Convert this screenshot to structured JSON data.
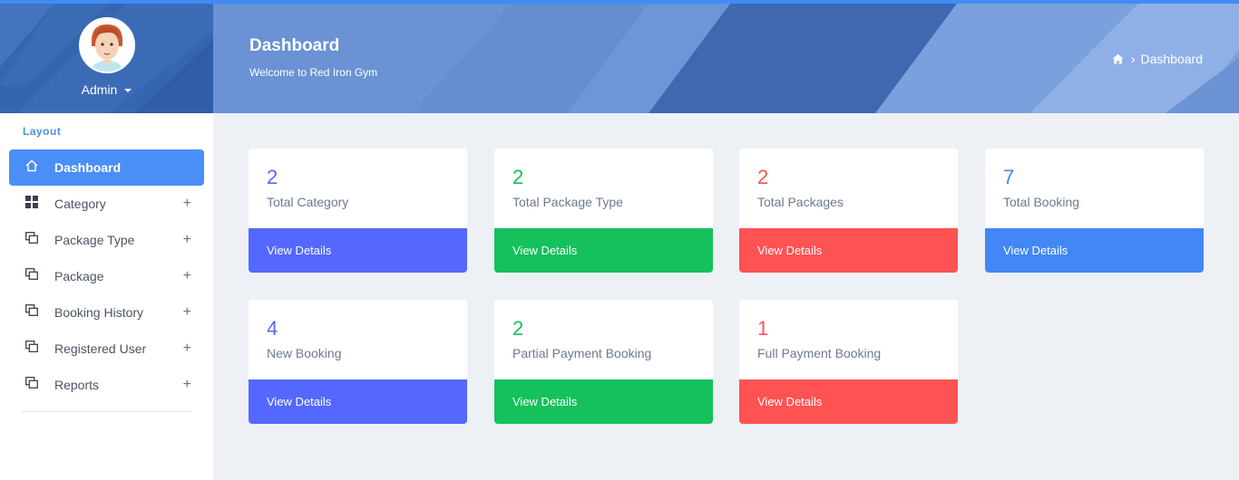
{
  "sidebar": {
    "user_label": "Admin",
    "nav_caption": "Layout",
    "items": [
      {
        "label": "Dashboard",
        "icon": "home-icon",
        "active": true
      },
      {
        "label": "Category",
        "icon": "grid-icon",
        "expandable": true
      },
      {
        "label": "Package Type",
        "icon": "windows-icon",
        "expandable": true
      },
      {
        "label": "Package",
        "icon": "windows-icon",
        "expandable": true
      },
      {
        "label": "Booking History",
        "icon": "windows-icon",
        "expandable": true
      },
      {
        "label": "Registered User",
        "icon": "windows-icon",
        "expandable": true
      },
      {
        "label": "Reports",
        "icon": "windows-icon",
        "expandable": true
      }
    ],
    "expand_symbol": "+"
  },
  "header": {
    "title": "Dashboard",
    "subtitle": "Welcome to Red Iron Gym",
    "breadcrumb": {
      "home_icon": "home-icon",
      "separator": "›",
      "current": "Dashboard"
    }
  },
  "colors": {
    "accent": "#4a8ff7",
    "indigo": "#5468ff",
    "green": "#14c15c",
    "red": "#ff5252",
    "blue": "#4287f5"
  },
  "cards": [
    {
      "value": "2",
      "caption": "Total Category",
      "link": "View Details",
      "color": "indigo"
    },
    {
      "value": "2",
      "caption": "Total Package Type",
      "link": "View Details",
      "color": "green"
    },
    {
      "value": "2",
      "caption": "Total Packages",
      "link": "View Details",
      "color": "red"
    },
    {
      "value": "7",
      "caption": "Total Booking",
      "link": "View Details",
      "color": "blue"
    },
    {
      "value": "4",
      "caption": "New Booking",
      "link": "View Details",
      "color": "indigo"
    },
    {
      "value": "2",
      "caption": "Partial Payment Booking",
      "link": "View Details",
      "color": "green"
    },
    {
      "value": "1",
      "caption": "Full Payment Booking",
      "link": "View Details",
      "color": "red"
    }
  ]
}
